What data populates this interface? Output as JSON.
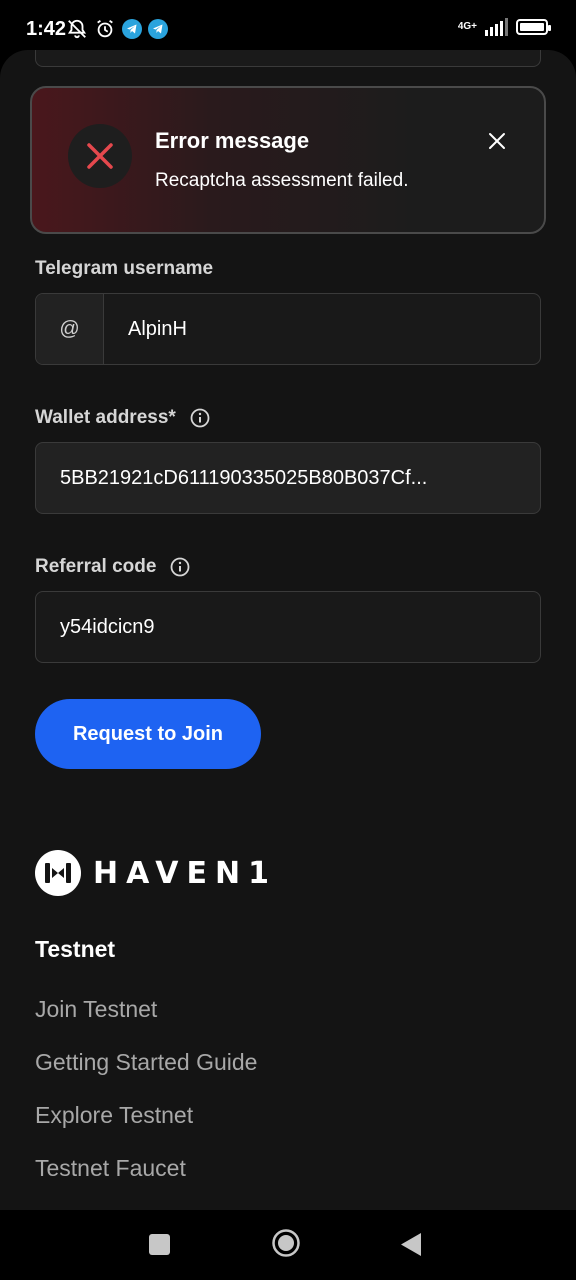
{
  "status_bar": {
    "time": "1:42",
    "network": "4G+",
    "signal_level": 4,
    "battery_level": 0.9
  },
  "colors": {
    "accent": "#1e63f2",
    "error": "#e5484d",
    "background": "#141414"
  },
  "alert": {
    "title": "Error message",
    "message": "Recaptcha assessment failed.",
    "icon": "x-mark-icon",
    "close_icon": "close-icon"
  },
  "form": {
    "telegram": {
      "label": "Telegram username",
      "prefix": "@",
      "value": "AlpinH"
    },
    "wallet": {
      "label": "Wallet address*",
      "value": "5BB21921cD611190335025B80B037Cf..."
    },
    "referral": {
      "label": "Referral code",
      "value": "y54idcicn9"
    },
    "submit_label": "Request to Join"
  },
  "footer": {
    "logo_text": "HAVEN1",
    "section_title": "Testnet",
    "links": [
      "Join Testnet",
      "Getting Started Guide",
      "Explore Testnet",
      "Testnet Faucet"
    ]
  }
}
